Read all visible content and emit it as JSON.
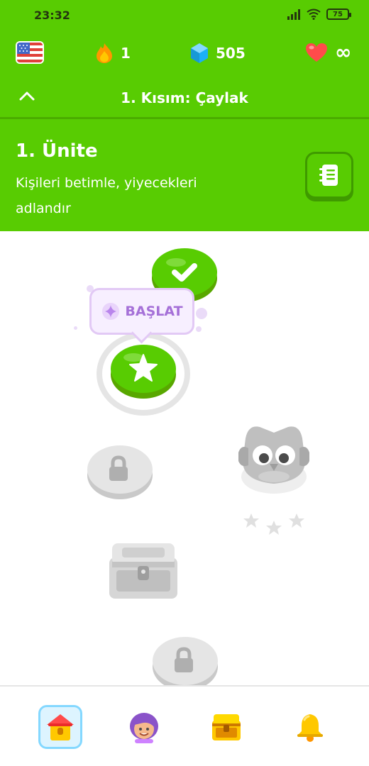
{
  "status_bar": {
    "time": "23:32",
    "battery": "75"
  },
  "header": {
    "flag_icon": "us-flag-icon",
    "streak_count": "1",
    "gems_count": "505",
    "hearts_value": "∞"
  },
  "section": {
    "title": "1. Kısım: Çaylak"
  },
  "unit": {
    "title": "1. Ünite",
    "description": "Kişileri betimle, yiyecekleri adlandır"
  },
  "path": {
    "start_label": "BAŞLAT"
  },
  "colors": {
    "brand_green": "#58cc02",
    "dark_green": "#3f9a00",
    "locked_gray": "#e5e5e5",
    "tooltip_purple": "#a570d8"
  },
  "nav": {
    "items": [
      "home-icon",
      "profile-icon",
      "quests-chest-icon",
      "notifications-bell-icon"
    ]
  }
}
